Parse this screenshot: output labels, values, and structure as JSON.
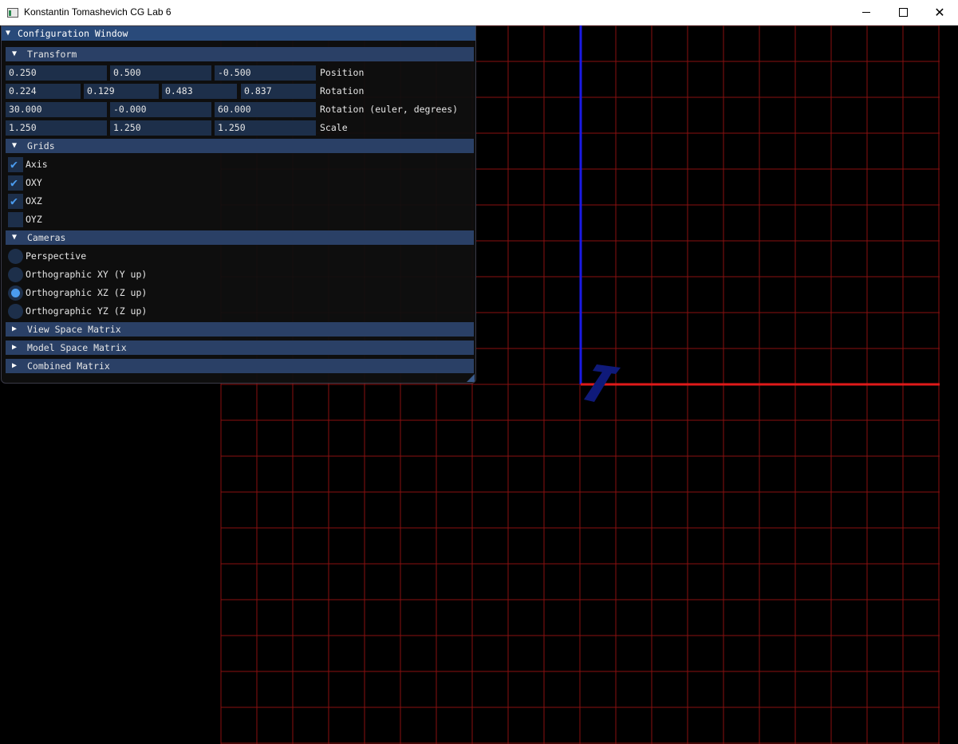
{
  "window": {
    "title": "Konstantin Tomashevich CG Lab 6",
    "icons": {
      "app": "app-window-icon",
      "minimize": "minimize-icon",
      "maximize": "maximize-icon",
      "close": "close-icon"
    }
  },
  "config": {
    "title": "Configuration Window",
    "transform": {
      "header": "Transform",
      "position": {
        "label": "Position",
        "values": [
          "0.250",
          "0.500",
          "-0.500"
        ]
      },
      "rotation": {
        "label": "Rotation",
        "values": [
          "0.224",
          "0.129",
          "0.483",
          "0.837"
        ]
      },
      "euler": {
        "label": "Rotation (euler, degrees)",
        "values": [
          "30.000",
          "-0.000",
          "60.000"
        ]
      },
      "scale": {
        "label": "Scale",
        "values": [
          "1.250",
          "1.250",
          "1.250"
        ]
      }
    },
    "grids": {
      "header": "Grids",
      "items": [
        {
          "label": "Axis",
          "checked": true
        },
        {
          "label": "OXY",
          "checked": true
        },
        {
          "label": "OXZ",
          "checked": true
        },
        {
          "label": "OYZ",
          "checked": false
        }
      ]
    },
    "cameras": {
      "header": "Cameras",
      "options": [
        "Perspective",
        "Orthographic XY (Y up)",
        "Orthographic XZ (Z up)",
        "Orthographic YZ (Z up)"
      ],
      "selected": "Orthographic XZ (Z up)"
    },
    "collapsed": {
      "view_matrix": "View Space Matrix",
      "model_matrix": "Model Space Matrix",
      "combined_matrix": "Combined Matrix"
    }
  },
  "colors": {
    "grid": "#8a1010",
    "axis_x": "#e01a1a",
    "axis_z": "#1a1ae6",
    "model": "#0f1a7a",
    "accent": "#4b9cf0",
    "header": "#2a4066",
    "title_active": "#294a7a"
  }
}
